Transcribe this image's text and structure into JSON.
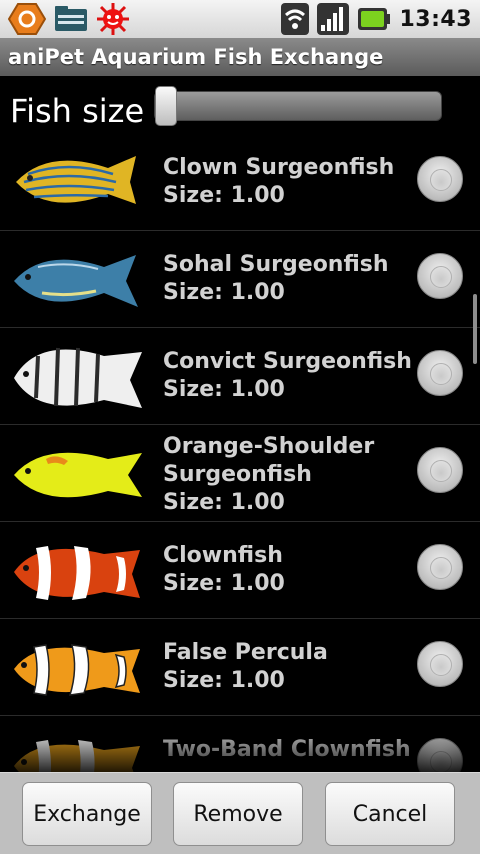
{
  "status_bar": {
    "time": "13:43",
    "icons": [
      "app-badge-icon",
      "folder-notification-icon",
      "bug-sun-icon",
      "wifi-icon",
      "signal-icon",
      "battery-icon"
    ]
  },
  "title": "aniPet Aquarium Fish Exchange",
  "size_control": {
    "label": "Fish size",
    "value_fraction": 0.0
  },
  "fish_list": [
    {
      "name": "Clown Surgeonfish",
      "size": "Size: 1.00",
      "icon": "clown-surgeonfish-image",
      "selected": false
    },
    {
      "name": "Sohal Surgeonfish",
      "size": "Size: 1.00",
      "icon": "sohal-surgeonfish-image",
      "selected": false
    },
    {
      "name": "Convict Surgeonfish",
      "size": "Size: 1.00",
      "icon": "convict-surgeonfish-image",
      "selected": false
    },
    {
      "name": "Orange-Shoulder Surgeonfish",
      "size": "Size: 1.00",
      "icon": "orange-shoulder-surgeonfish-image",
      "selected": false
    },
    {
      "name": "Clownfish",
      "size": "Size: 1.00",
      "icon": "clownfish-image",
      "selected": false
    },
    {
      "name": "False Percula",
      "size": "Size: 1.00",
      "icon": "false-percula-image",
      "selected": false
    },
    {
      "name": "Two-Band Clownfish",
      "size": "",
      "icon": "two-band-clownfish-image",
      "selected": false
    }
  ],
  "buttons": {
    "exchange": "Exchange",
    "remove": "Remove",
    "cancel": "Cancel"
  },
  "colors": {
    "background": "#000000",
    "title_bar": "#6f6f6f",
    "status_bar": "#e4e4e4",
    "button_bar": "#bfbfbf",
    "list_text": "#d2d2d2"
  }
}
